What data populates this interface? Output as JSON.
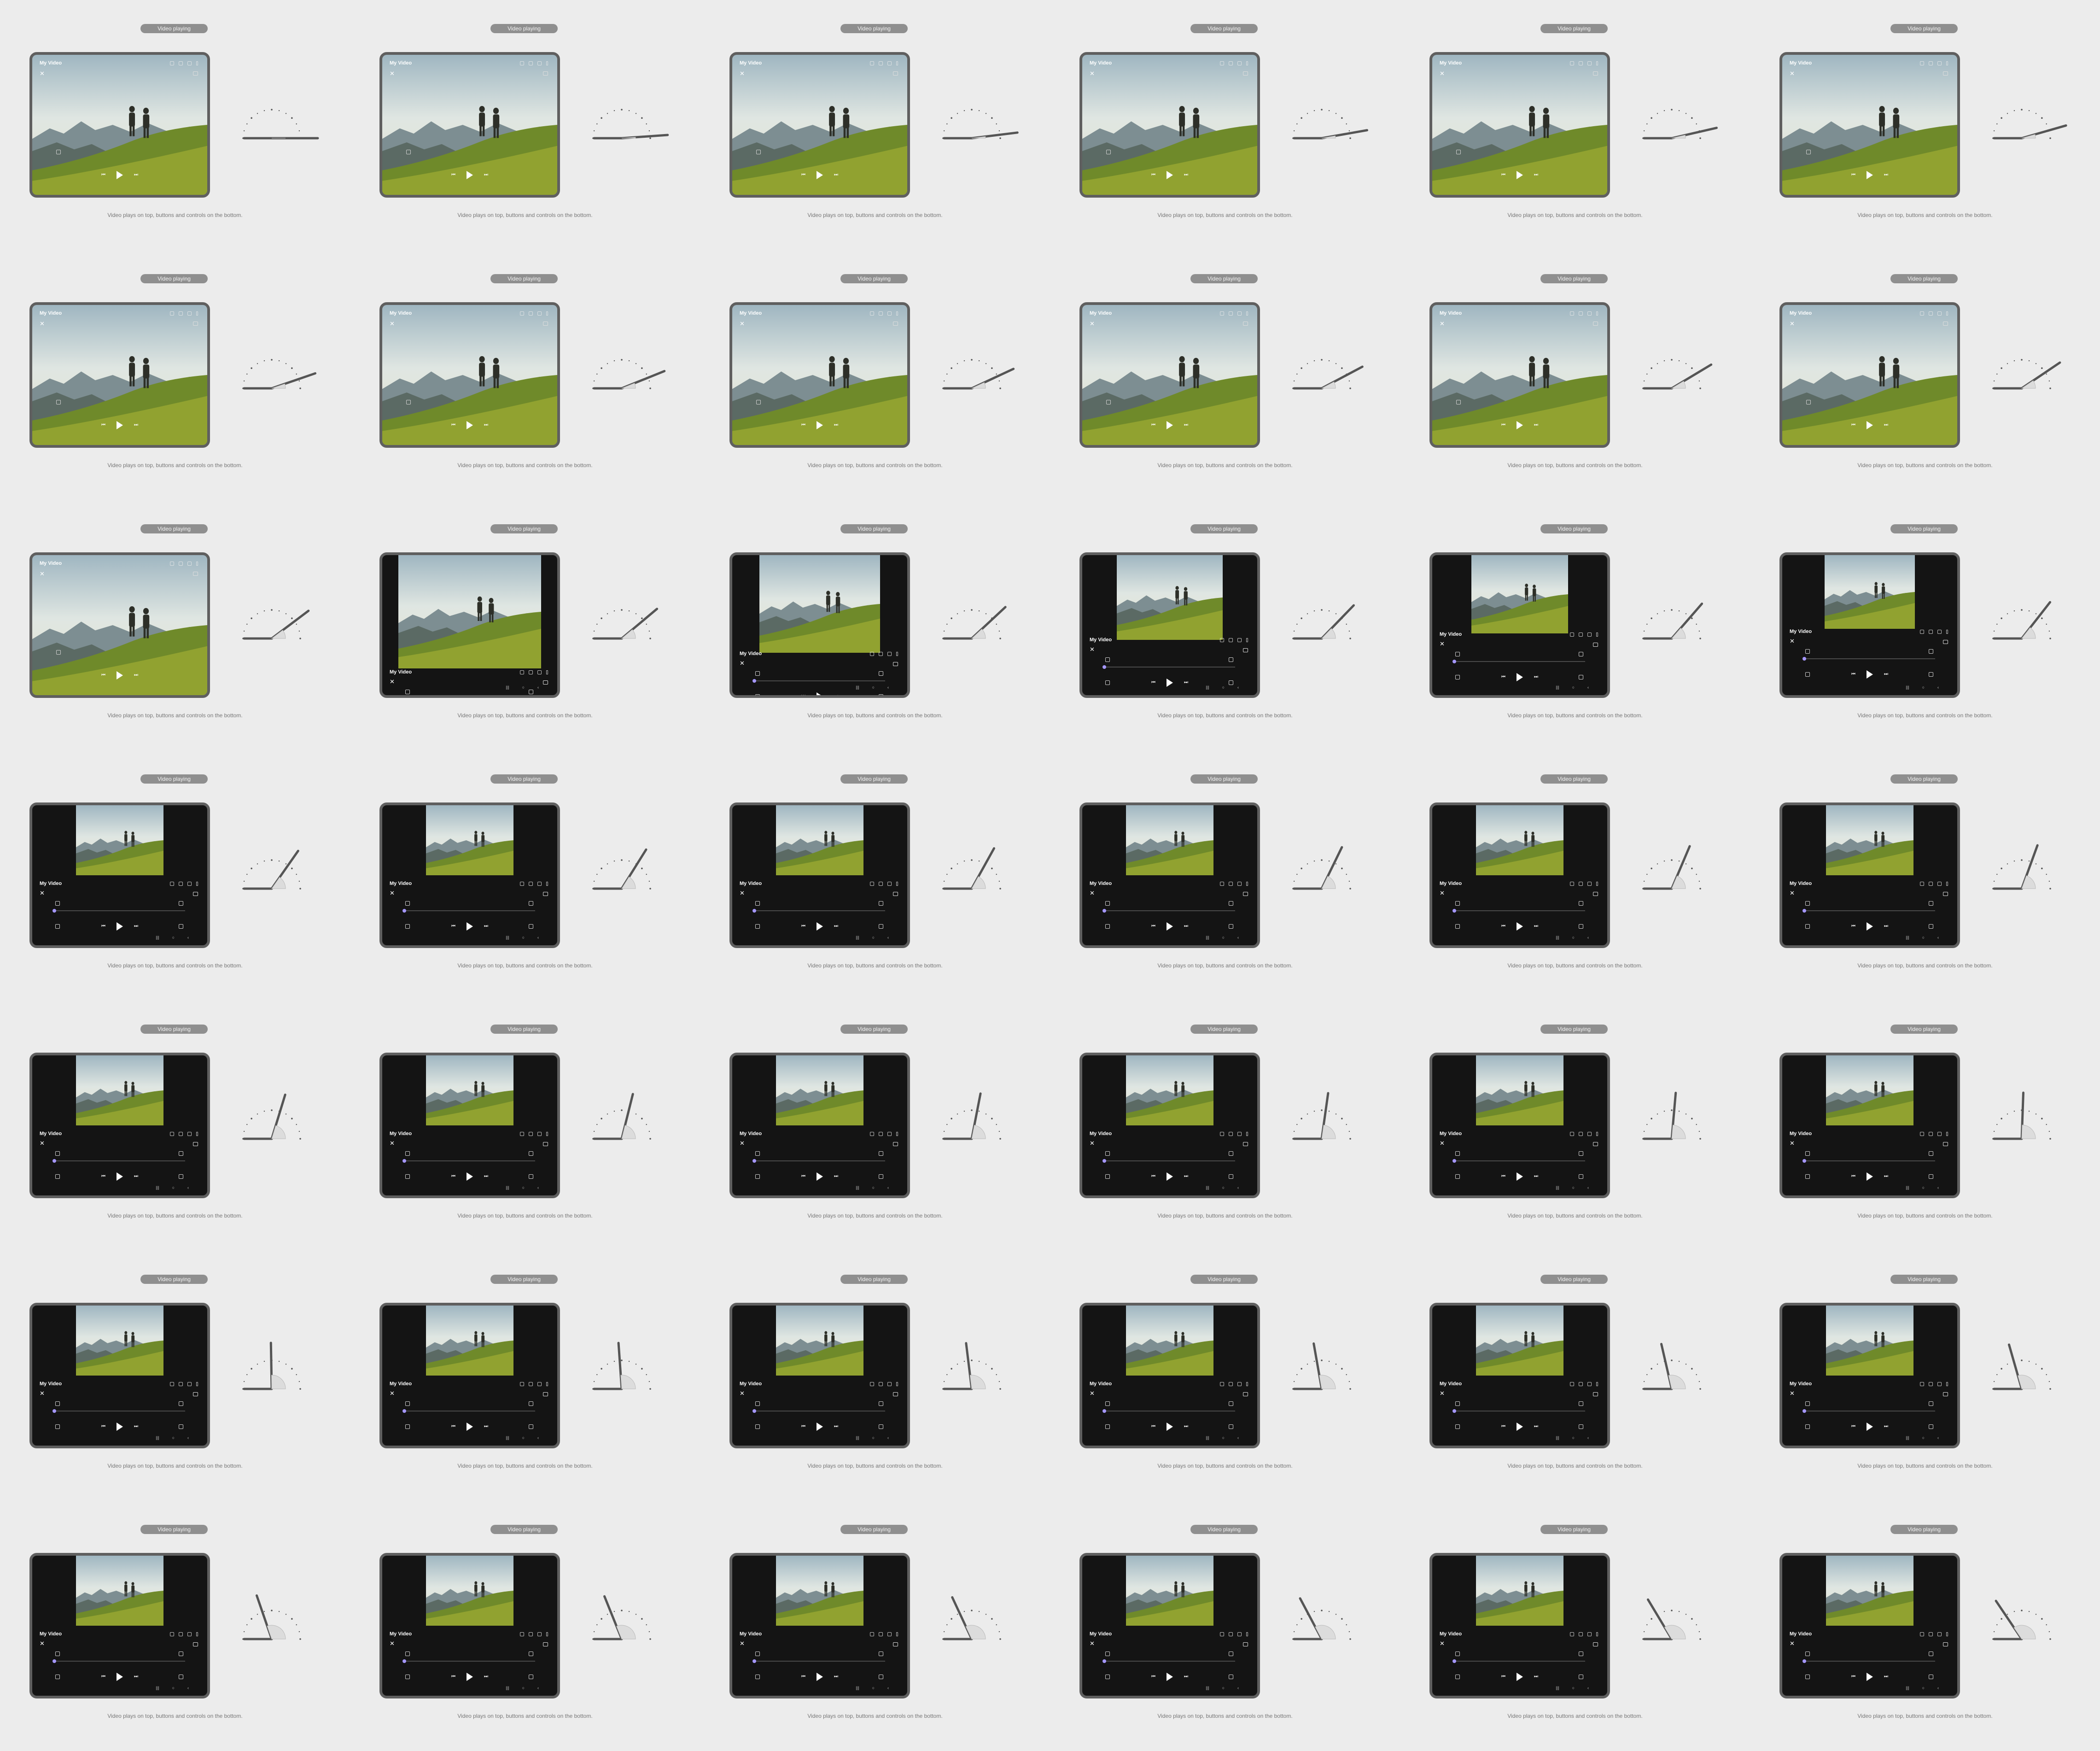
{
  "cells": [
    {
      "badge": "Video playing",
      "title": "My Video",
      "caption": "Video plays on top, buttons and controls on the bottom.",
      "fold_angle_deg": 180,
      "layout": "full"
    },
    {
      "badge": "Video playing",
      "title": "My Video",
      "caption": "Video plays on top, buttons and controls on the bottom.",
      "fold_angle_deg": 176,
      "layout": "full"
    },
    {
      "badge": "Video playing",
      "title": "My Video",
      "caption": "Video plays on top, buttons and controls on the bottom.",
      "fold_angle_deg": 173,
      "layout": "full"
    },
    {
      "badge": "Video playing",
      "title": "My Video",
      "caption": "Video plays on top, buttons and controls on the bottom.",
      "fold_angle_deg": 170,
      "layout": "full"
    },
    {
      "badge": "Video playing",
      "title": "My Video",
      "caption": "Video plays on top, buttons and controls on the bottom.",
      "fold_angle_deg": 167,
      "layout": "full"
    },
    {
      "badge": "Video playing",
      "title": "My Video",
      "caption": "Video plays on top, buttons and controls on the bottom.",
      "fold_angle_deg": 164,
      "layout": "full"
    },
    {
      "badge": "Video playing",
      "title": "My Video",
      "caption": "Video plays on top, buttons and controls on the bottom.",
      "fold_angle_deg": 161,
      "layout": "full"
    },
    {
      "badge": "Video playing",
      "title": "My Video",
      "caption": "Video plays on top, buttons and controls on the bottom.",
      "fold_angle_deg": 158,
      "layout": "full"
    },
    {
      "badge": "Video playing",
      "title": "My Video",
      "caption": "Video plays on top, buttons and controls on the bottom.",
      "fold_angle_deg": 155,
      "layout": "full"
    },
    {
      "badge": "Video playing",
      "title": "My Video",
      "caption": "Video plays on top, buttons and controls on the bottom.",
      "fold_angle_deg": 152,
      "layout": "full"
    },
    {
      "badge": "Video playing",
      "title": "My Video",
      "caption": "Video plays on top, buttons and controls on the bottom.",
      "fold_angle_deg": 149,
      "layout": "full"
    },
    {
      "badge": "Video playing",
      "title": "My Video",
      "caption": "Video plays on top, buttons and controls on the bottom.",
      "fold_angle_deg": 146,
      "layout": "full"
    },
    {
      "badge": "Video playing",
      "title": "My Video",
      "caption": "Video plays on top, buttons and controls on the bottom.",
      "fold_angle_deg": 143,
      "layout": "full"
    },
    {
      "badge": "Video playing",
      "title": "My Video",
      "caption": "Video plays on top, buttons and controls on the bottom.",
      "fold_angle_deg": 140,
      "layout": "t1"
    },
    {
      "badge": "Video playing",
      "title": "My Video",
      "caption": "Video plays on top, buttons and controls on the bottom.",
      "fold_angle_deg": 137,
      "layout": "t2"
    },
    {
      "badge": "Video playing",
      "title": "My Video",
      "caption": "Video plays on top, buttons and controls on the bottom.",
      "fold_angle_deg": 134,
      "layout": "t3"
    },
    {
      "badge": "Video playing",
      "title": "My Video",
      "caption": "Video plays on top, buttons and controls on the bottom.",
      "fold_angle_deg": 131,
      "layout": "t4"
    },
    {
      "badge": "Video playing",
      "title": "My Video",
      "caption": "Video plays on top, buttons and controls on the bottom.",
      "fold_angle_deg": 128,
      "layout": "t5"
    },
    {
      "badge": "Video playing",
      "title": "My Video",
      "caption": "Video plays on top, buttons and controls on the bottom.",
      "fold_angle_deg": 125,
      "layout": "split"
    },
    {
      "badge": "Video playing",
      "title": "My Video",
      "caption": "Video plays on top, buttons and controls on the bottom.",
      "fold_angle_deg": 122,
      "layout": "split"
    },
    {
      "badge": "Video playing",
      "title": "My Video",
      "caption": "Video plays on top, buttons and controls on the bottom.",
      "fold_angle_deg": 119,
      "layout": "split"
    },
    {
      "badge": "Video playing",
      "title": "My Video",
      "caption": "Video plays on top, buttons and controls on the bottom.",
      "fold_angle_deg": 116,
      "layout": "split"
    },
    {
      "badge": "Video playing",
      "title": "My Video",
      "caption": "Video plays on top, buttons and controls on the bottom.",
      "fold_angle_deg": 113,
      "layout": "split"
    },
    {
      "badge": "Video playing",
      "title": "My Video",
      "caption": "Video plays on top, buttons and controls on the bottom.",
      "fold_angle_deg": 110,
      "layout": "split"
    },
    {
      "badge": "Video playing",
      "title": "My Video",
      "caption": "Video plays on top, buttons and controls on the bottom.",
      "fold_angle_deg": 107,
      "layout": "split"
    },
    {
      "badge": "Video playing",
      "title": "My Video",
      "caption": "Video plays on top, buttons and controls on the bottom.",
      "fold_angle_deg": 104,
      "layout": "split"
    },
    {
      "badge": "Video playing",
      "title": "My Video",
      "caption": "Video plays on top, buttons and controls on the bottom.",
      "fold_angle_deg": 101,
      "layout": "split"
    },
    {
      "badge": "Video playing",
      "title": "My Video",
      "caption": "Video plays on top, buttons and controls on the bottom.",
      "fold_angle_deg": 98,
      "layout": "split"
    },
    {
      "badge": "Video playing",
      "title": "My Video",
      "caption": "Video plays on top, buttons and controls on the bottom.",
      "fold_angle_deg": 95,
      "layout": "split"
    },
    {
      "badge": "Video playing",
      "title": "My Video",
      "caption": "Video plays on top, buttons and controls on the bottom.",
      "fold_angle_deg": 92,
      "layout": "split"
    },
    {
      "badge": "Video playing",
      "title": "My Video",
      "caption": "Video plays on top, buttons and controls on the bottom.",
      "fold_angle_deg": 89,
      "layout": "split"
    },
    {
      "badge": "Video playing",
      "title": "My Video",
      "caption": "Video plays on top, buttons and controls on the bottom.",
      "fold_angle_deg": 86,
      "layout": "split"
    },
    {
      "badge": "Video playing",
      "title": "My Video",
      "caption": "Video plays on top, buttons and controls on the bottom.",
      "fold_angle_deg": 83,
      "layout": "split"
    },
    {
      "badge": "Video playing",
      "title": "My Video",
      "caption": "Video plays on top, buttons and controls on the bottom.",
      "fold_angle_deg": 80,
      "layout": "split"
    },
    {
      "badge": "Video playing",
      "title": "My Video",
      "caption": "Video plays on top, buttons and controls on the bottom.",
      "fold_angle_deg": 77,
      "layout": "split"
    },
    {
      "badge": "Video playing",
      "title": "My Video",
      "caption": "Video plays on top, buttons and controls on the bottom.",
      "fold_angle_deg": 74,
      "layout": "split"
    },
    {
      "badge": "Video playing",
      "title": "My Video",
      "caption": "Video plays on top, buttons and controls on the bottom.",
      "fold_angle_deg": 71,
      "layout": "split"
    },
    {
      "badge": "Video playing",
      "title": "My Video",
      "caption": "Video plays on top, buttons and controls on the bottom.",
      "fold_angle_deg": 68,
      "layout": "split"
    },
    {
      "badge": "Video playing",
      "title": "My Video",
      "caption": "Video plays on top, buttons and controls on the bottom.",
      "fold_angle_deg": 65,
      "layout": "split"
    },
    {
      "badge": "Video playing",
      "title": "My Video",
      "caption": "Video plays on top, buttons and controls on the bottom.",
      "fold_angle_deg": 62,
      "layout": "split"
    },
    {
      "badge": "Video playing",
      "title": "My Video",
      "caption": "Video plays on top, buttons and controls on the bottom.",
      "fold_angle_deg": 59,
      "layout": "split"
    },
    {
      "badge": "Video playing",
      "title": "My Video",
      "caption": "Video plays on top, buttons and controls on the bottom.",
      "fold_angle_deg": 56,
      "layout": "split"
    }
  ],
  "icons": {
    "close": "close-icon",
    "play": "play-icon",
    "prev": "previous-icon",
    "next": "next-icon",
    "pip": "picture-in-picture-icon",
    "captions": "captions-icon",
    "cast": "cast-icon",
    "more": "more-vert-icon",
    "nav_back": "nav-back-icon",
    "nav_home": "nav-home-icon",
    "nav_recent": "nav-recents-icon"
  },
  "colors": {
    "background": "#ececec",
    "device_frame": "#5f5f5f",
    "screen": "#141414",
    "accent": "#9d8df0",
    "badge": "#8f8f8f"
  }
}
